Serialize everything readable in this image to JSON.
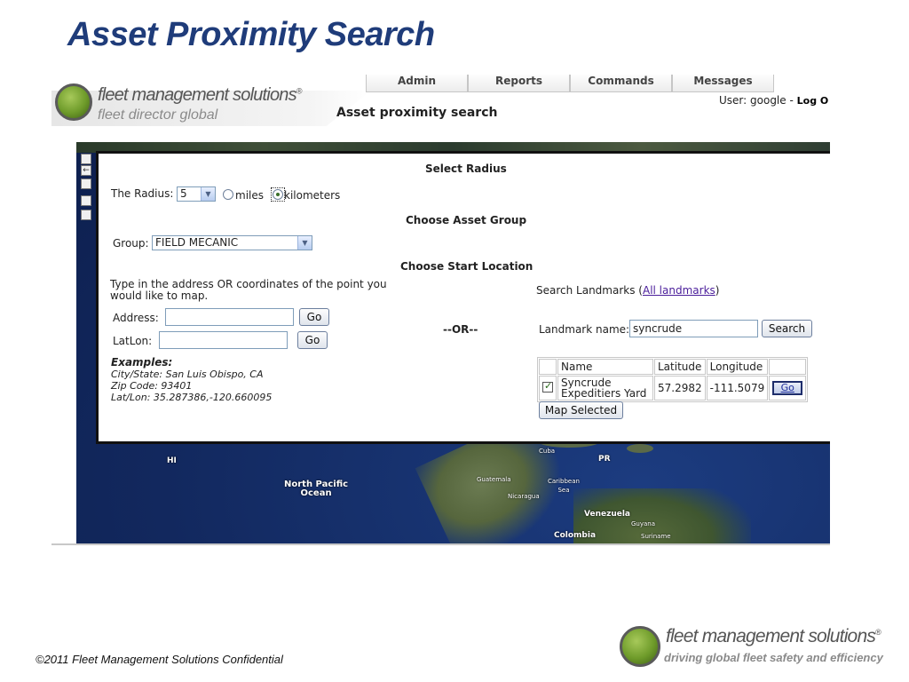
{
  "slide": {
    "title": "Asset Proximity Search",
    "footer_copyright": "©2011 Fleet Management Solutions Confidential",
    "footer_brand": "fleet management solutions",
    "footer_brand_mark": "®",
    "footer_tagline": "driving global fleet safety and efficiency"
  },
  "app": {
    "brand_name": "fleet management solutions",
    "brand_mark": "®",
    "brand_sub": "fleet director global",
    "tabs": [
      {
        "label": "Admin"
      },
      {
        "label": "Reports"
      },
      {
        "label": "Commands"
      },
      {
        "label": "Messages"
      }
    ],
    "user_prefix": "User:",
    "user_name": "google",
    "separator": "-",
    "logout_label": "Log O",
    "page_heading": "Asset proximity search"
  },
  "map": {
    "controls": [
      "",
      "←",
      "",
      "",
      ""
    ],
    "labels": {
      "hi": "HI",
      "north_pacific": "North Pacific",
      "ocean": "Ocean",
      "cuba": "Cuba",
      "pr": "PR",
      "guatemala": "Guatemala",
      "caribbean": "Caribbean",
      "sea": "Sea",
      "nicaragua": "Nicaragua",
      "venezuela": "Venezuela",
      "guyana": "Guyana",
      "colombia": "Colombia",
      "suriname": "Suriname"
    }
  },
  "dialog": {
    "select_radius_heading": "Select Radius",
    "radius_label": "The Radius:",
    "radius_value": "5",
    "miles_label": "miles",
    "kilometers_label": "kilometers",
    "choose_group_heading": "Choose Asset Group",
    "group_label": "Group:",
    "group_value": "FIELD MECANIC",
    "choose_start_heading": "Choose Start Location",
    "instructions_line1": "Type in the address OR coordinates of the point you",
    "instructions_line2": "would like to map.",
    "address_label": "Address:",
    "address_value": "",
    "latlon_label": "LatLon:",
    "latlon_value": "",
    "go_label": "Go",
    "examples_title": "Examples:",
    "example_city": "City/State: San Luis Obispo, CA",
    "example_zip": "Zip Code: 93401",
    "example_latlon": "Lat/Lon: 35.287386,-120.660095",
    "or_label": "--OR--",
    "search_landmarks_prefix": "Search Landmarks (",
    "all_landmarks_link": "All landmarks",
    "search_landmarks_suffix": ")",
    "landmark_name_label": "Landmark name:",
    "landmark_name_value": "syncrude",
    "search_button": "Search",
    "table": {
      "columns": [
        "",
        "Name",
        "Latitude",
        "Longitude",
        ""
      ],
      "rows": [
        {
          "name_line1": "Syncrude",
          "name_line2": "Expeditiers Yard",
          "latitude": "57.2982",
          "longitude": "-111.5079",
          "go": "Go",
          "checked": true
        }
      ]
    },
    "map_selected_button": "Map Selected"
  }
}
